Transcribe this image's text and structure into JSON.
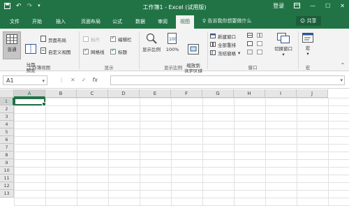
{
  "window": {
    "title": "工作簿1 - Excel (试用版)",
    "login": "登录",
    "share": "共享"
  },
  "tabs": [
    "文件",
    "开始",
    "插入",
    "页面布局",
    "公式",
    "数据",
    "审阅",
    "视图"
  ],
  "active_tab": "视图",
  "tell_me": "告诉我你想要做什么",
  "ribbon": {
    "workbook_views": {
      "label": "工作簿视图",
      "normal": "普通",
      "page_break_preview": "分页\n预览",
      "page_layout": "页面布局",
      "custom_views": "自定义视图"
    },
    "show": {
      "label": "显示",
      "ruler": "标尺",
      "formula_bar": "编辑栏",
      "gridlines": "网格线",
      "headings": "标题"
    },
    "zoom": {
      "label": "显示比例",
      "zoom": "显示比例",
      "zoom100": "100%",
      "zoom_selection": "缩放到\n选定区域"
    },
    "window": {
      "label": "窗口",
      "new_window": "新建窗口",
      "arrange_all": "全部重排",
      "freeze_panes": "冻结窗格",
      "switch_windows": "切换窗口"
    },
    "macros": {
      "label": "宏",
      "macros": "宏"
    }
  },
  "formula_bar": {
    "name_box": "A1",
    "content": ""
  },
  "sheet": {
    "columns": [
      "A",
      "B",
      "C",
      "D",
      "E",
      "F",
      "G",
      "H",
      "I",
      "J"
    ],
    "rows": [
      "1",
      "2",
      "3",
      "4",
      "5",
      "6",
      "7",
      "8",
      "9",
      "10",
      "11",
      "12",
      "13"
    ],
    "selected_cell": "A1"
  },
  "colors": {
    "brand": "#217346",
    "ribbon_bg": "#f3f3f3"
  }
}
